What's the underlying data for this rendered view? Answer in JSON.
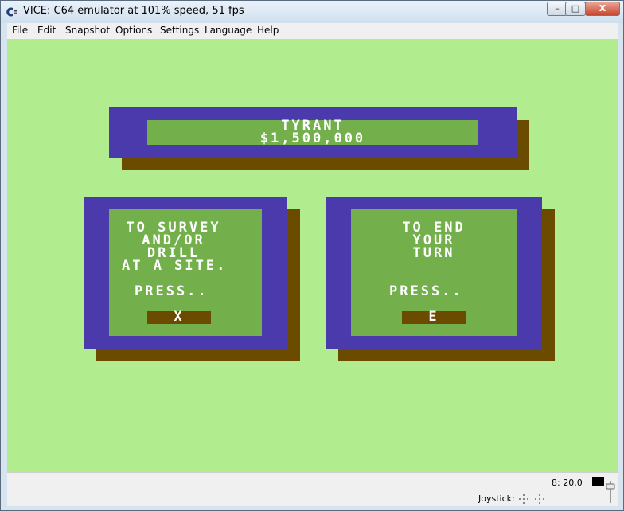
{
  "window": {
    "title": "VICE: C64 emulator at 101% speed, 51 fps",
    "buttons": {
      "minimize": "–",
      "maximize": "□",
      "close": "X"
    }
  },
  "menu": [
    "File",
    "Edit",
    "Snapshot",
    "Options",
    "Settings",
    "Language",
    "Help"
  ],
  "c64": {
    "header": {
      "line1": "TYRANT",
      "line2": "$1,500,000"
    },
    "left_panel": {
      "lines": [
        "TO SURVEY",
        "AND/OR",
        "DRILL",
        "AT A SITE."
      ],
      "press": "PRESS..",
      "key": "X"
    },
    "right_panel": {
      "lines": [
        "TO END",
        "YOUR",
        "TURN"
      ],
      "press": "PRESS..",
      "key": "E"
    },
    "colors": {
      "background": "#b1ec8e",
      "frame": "#4a3aab",
      "inner": "#73b04c",
      "shadow": "#6a4b00",
      "text": "#ffffff"
    }
  },
  "status": {
    "drive": "8: 20.0",
    "joystick_label": "Joystick:"
  },
  "icons": [
    "commodore-icon",
    "joystick-port1-icon",
    "joystick-port2-icon",
    "volume-slider-icon",
    "drive-led-icon"
  ]
}
